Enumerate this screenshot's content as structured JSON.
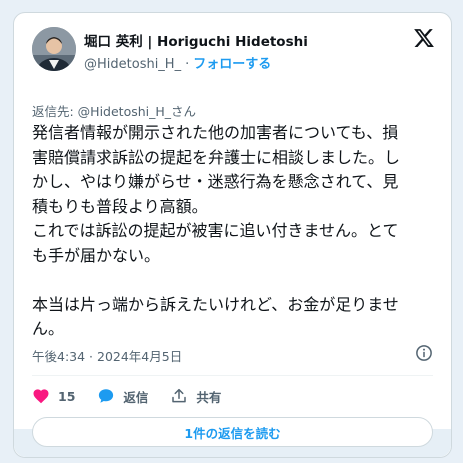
{
  "author": {
    "display_name": "堀口 英利 | Horiguchi Hidetoshi",
    "handle": "@Hidetoshi_H_",
    "separator": "·",
    "follow_label": "フォローする"
  },
  "reply_to": "返信先: @Hidetoshi_H_さん",
  "tweet_lines": [
    "発信者情報が開示された他の加害者についても、損",
    "害賠償請求訴訟の提起を弁護士に相談しました。し",
    "かし、やはり嫌がらせ・迷惑行為を懸念されて、見",
    "積もりも普段より高額。",
    "これでは訴訟の提起が被害に追い付きません。とて",
    "も手が届かない。",
    "",
    "本当は片っ端から訴えたいけれど、お金が足りませ",
    "ん。"
  ],
  "timestamp": "午後4:34 · 2024年4月5日",
  "actions": {
    "like_count": "15",
    "reply_label": "返信",
    "share_label": "共有"
  },
  "read_replies_label": "1件の返信を読む",
  "colors": {
    "accent": "#1d9bf0",
    "like": "#f91880",
    "muted": "#536471"
  },
  "icons": {
    "platform": "x-logo-icon",
    "info": "info-icon",
    "like": "heart-icon",
    "reply": "reply-bubble-icon",
    "share": "share-icon"
  }
}
